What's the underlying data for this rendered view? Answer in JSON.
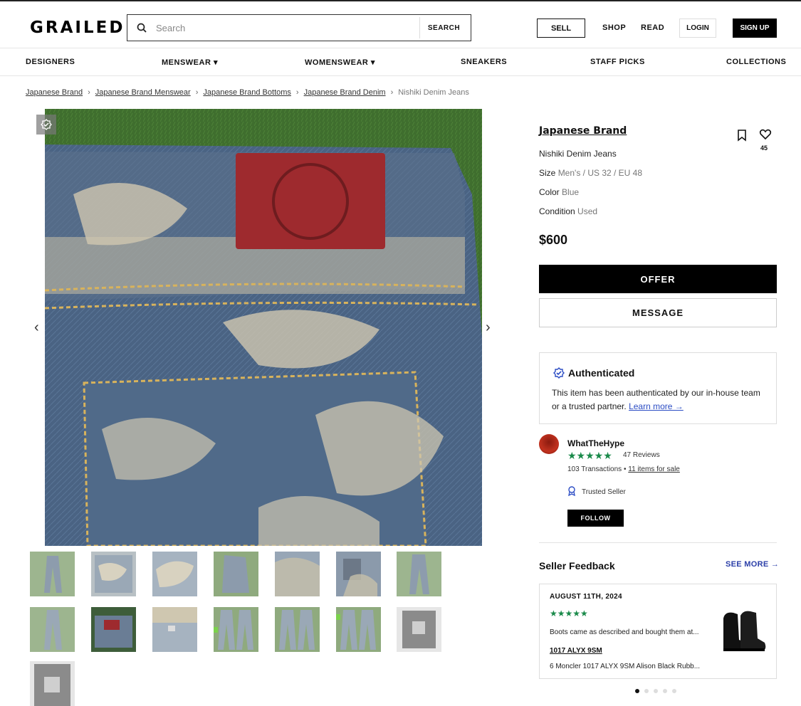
{
  "header": {
    "logo": "GRAILED",
    "search_placeholder": "Search",
    "search_button": "SEARCH",
    "sell": "SELL",
    "shop": "SHOP",
    "read": "READ",
    "login": "LOGIN",
    "signup": "SIGN UP"
  },
  "catnav": {
    "designers": "DESIGNERS",
    "menswear": "MENSWEAR ▾",
    "womenswear": "WOMENSWEAR ▾",
    "sneakers": "SNEAKERS",
    "staff_picks": "STAFF PICKS",
    "collections": "COLLECTIONS"
  },
  "breadcrumb": {
    "items": [
      "Japanese Brand",
      "Japanese Brand Menswear",
      "Japanese Brand Bottoms",
      "Japanese Brand Denim"
    ],
    "current": "Nishiki Denim Jeans",
    "separator": "›"
  },
  "gallery": {
    "prev": "‹",
    "next": "›"
  },
  "listing": {
    "brand": "Japanese Brand",
    "name": "Nishiki Denim Jeans",
    "size_label": "Size",
    "size_value": "Men's / US 32 / EU 48",
    "color_label": "Color",
    "color_value": "Blue",
    "condition_label": "Condition",
    "condition_value": "Used",
    "likes": "45",
    "price": "$600",
    "offer": "OFFER",
    "message": "MESSAGE"
  },
  "auth": {
    "title": "Authenticated",
    "text": "This item has been authenticated by our in-house team or a trusted partner.",
    "link": "Learn more →"
  },
  "seller": {
    "name": "WhatTheHype",
    "stars": "★★★★★",
    "reviews": "47 Reviews",
    "transactions": "103 Transactions",
    "bullet": "•",
    "items_for_sale": "11 items for sale",
    "trusted": "Trusted Seller",
    "follow": "FOLLOW"
  },
  "feedback": {
    "title": "Seller Feedback",
    "see_more": "SEE MORE →",
    "date": "AUGUST 11TH, 2024",
    "stars": "★★★★★",
    "text": "Boots came as described and bought them at...",
    "item": "1017 ALYX 9SM",
    "item_desc": "6 Moncler 1017 ALYX 9SM Alison Black Rubb...",
    "active_dot": 1,
    "total_dots": 5
  },
  "colors": {
    "accent_blue": "#2b3fa8",
    "star_green": "#1a8a4a",
    "black": "#000000"
  }
}
